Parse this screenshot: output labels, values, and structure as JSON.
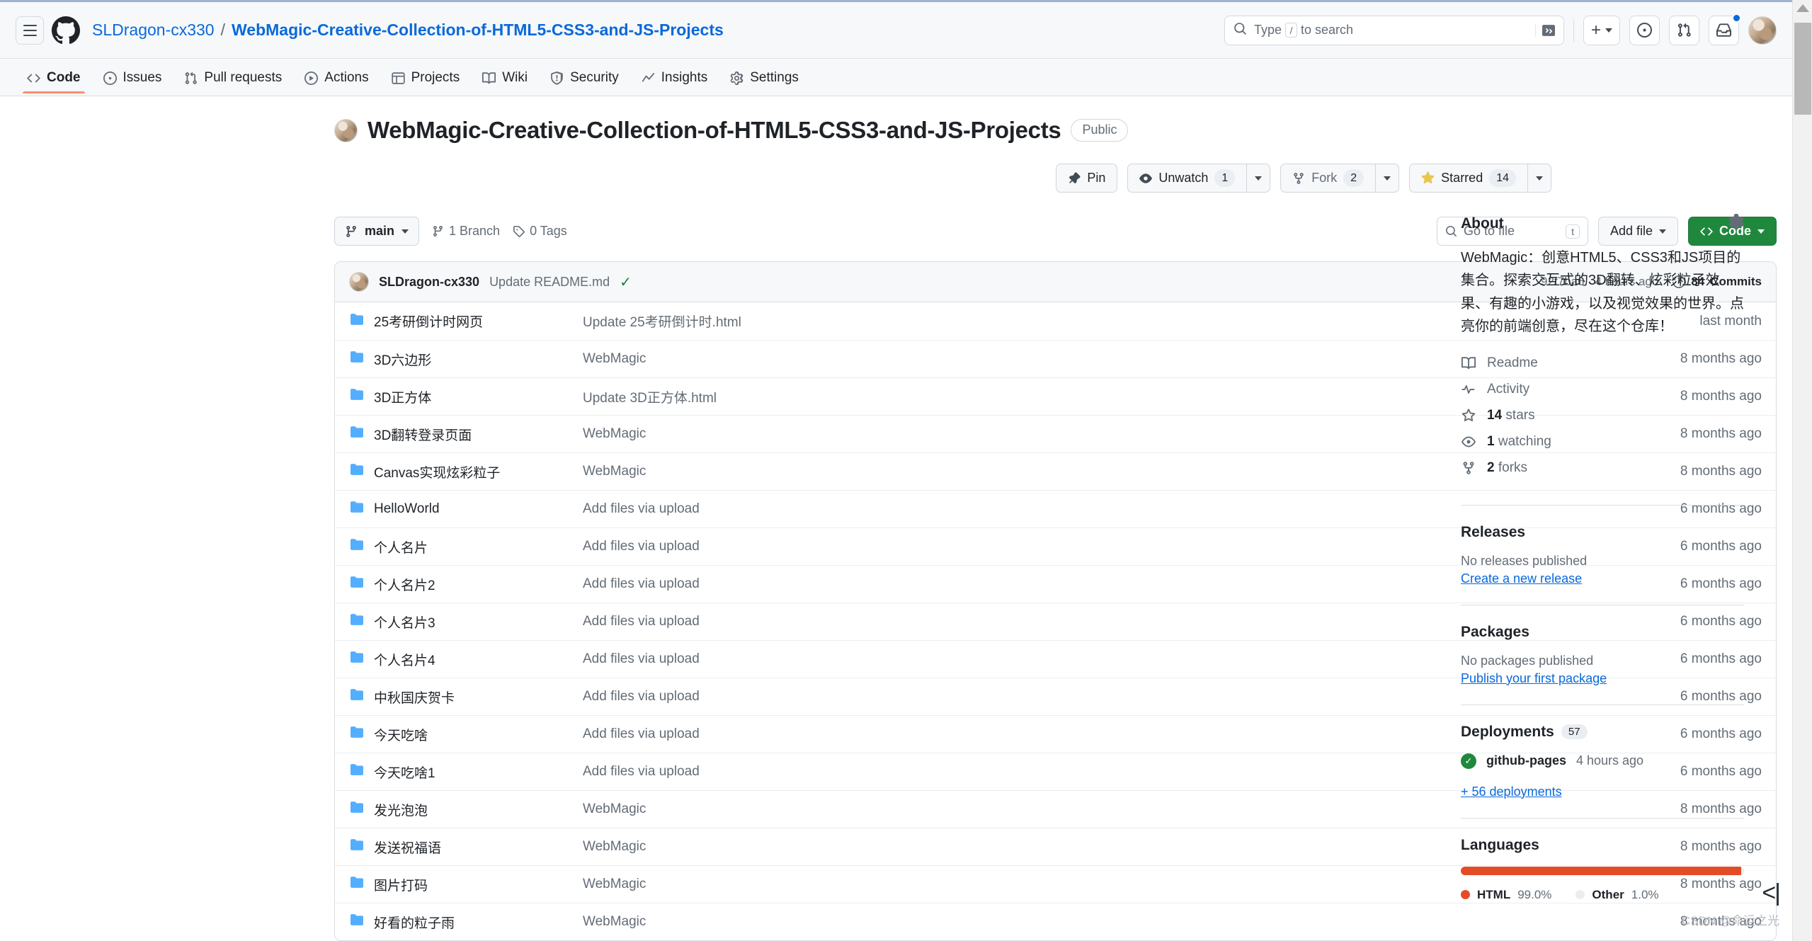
{
  "header": {
    "menu_icon": "hamburger-icon",
    "logo_icon": "github-mark-icon",
    "owner": "SLDragon-cx330",
    "separator": "/",
    "repo": "WebMagic-Creative-Collection-of-HTML5-CSS3-and-JS-Projects",
    "search_placeholder_before": "Type",
    "search_key": "/",
    "search_placeholder_after": "to search",
    "terminal_icon": "command-palette-icon",
    "plus_label": "+",
    "issue_icon": "issue-opened-icon",
    "pull_icon": "pull-request-icon",
    "inbox_icon": "inbox-icon",
    "avatar": "user-avatar"
  },
  "nav": {
    "tabs": [
      {
        "label": "Code",
        "icon": "code-icon",
        "active": true
      },
      {
        "label": "Issues",
        "icon": "issue-opened-icon",
        "active": false
      },
      {
        "label": "Pull requests",
        "icon": "git-pull-request-icon",
        "active": false
      },
      {
        "label": "Actions",
        "icon": "play-icon",
        "active": false
      },
      {
        "label": "Projects",
        "icon": "table-icon",
        "active": false
      },
      {
        "label": "Wiki",
        "icon": "book-icon",
        "active": false
      },
      {
        "label": "Security",
        "icon": "shield-icon",
        "active": false
      },
      {
        "label": "Insights",
        "icon": "graph-icon",
        "active": false
      },
      {
        "label": "Settings",
        "icon": "gear-icon",
        "active": false
      }
    ]
  },
  "repo": {
    "name": "WebMagic-Creative-Collection-of-HTML5-CSS3-and-JS-Projects",
    "visibility": "Public",
    "actions": {
      "pin": "Pin",
      "watch": "Unwatch",
      "watch_count": "1",
      "fork": "Fork",
      "fork_count": "2",
      "star": "Starred",
      "star_count": "14"
    }
  },
  "toolbar": {
    "branch": "main",
    "branches": "1 Branch",
    "tags": "0 Tags",
    "go_to_file": "Go to file",
    "file_key": "t",
    "add_file": "Add file",
    "code": "Code"
  },
  "commit_bar": {
    "author": "SLDragon-cx330",
    "message": "Update README.md",
    "status_icon": "check-icon",
    "hash": "92f7ba6 · 4 hours ago",
    "commits_count": "84",
    "commits_label": "Commits"
  },
  "files": [
    {
      "name": "25考研倒计时网页",
      "type": "folder",
      "message": "Update 25考研倒计时.html",
      "time": "last month"
    },
    {
      "name": "3D六边形",
      "type": "folder",
      "message": "WebMagic",
      "time": "8 months ago"
    },
    {
      "name": "3D正方体",
      "type": "folder",
      "message": "Update 3D正方体.html",
      "time": "8 months ago"
    },
    {
      "name": "3D翻转登录页面",
      "type": "folder",
      "message": "WebMagic",
      "time": "8 months ago"
    },
    {
      "name": "Canvas实现炫彩粒子",
      "type": "folder",
      "message": "WebMagic",
      "time": "8 months ago"
    },
    {
      "name": "HelloWorld",
      "type": "folder",
      "message": "Add files via upload",
      "time": "6 months ago"
    },
    {
      "name": "个人名片",
      "type": "folder",
      "message": "Add files via upload",
      "time": "6 months ago"
    },
    {
      "name": "个人名片2",
      "type": "folder",
      "message": "Add files via upload",
      "time": "6 months ago"
    },
    {
      "name": "个人名片3",
      "type": "folder",
      "message": "Add files via upload",
      "time": "6 months ago"
    },
    {
      "name": "个人名片4",
      "type": "folder",
      "message": "Add files via upload",
      "time": "6 months ago"
    },
    {
      "name": "中秋国庆贺卡",
      "type": "folder",
      "message": "Add files via upload",
      "time": "6 months ago"
    },
    {
      "name": "今天吃啥",
      "type": "folder",
      "message": "Add files via upload",
      "time": "6 months ago"
    },
    {
      "name": "今天吃啥1",
      "type": "folder",
      "message": "Add files via upload",
      "time": "6 months ago"
    },
    {
      "name": "发光泡泡",
      "type": "folder",
      "message": "WebMagic",
      "time": "8 months ago"
    },
    {
      "name": "发送祝福语",
      "type": "folder",
      "message": "WebMagic",
      "time": "8 months ago"
    },
    {
      "name": "图片打码",
      "type": "folder",
      "message": "WebMagic",
      "time": "8 months ago"
    },
    {
      "name": "好看的粒子雨",
      "type": "folder",
      "message": "WebMagic",
      "time": "8 months ago"
    }
  ],
  "sidebar": {
    "about": {
      "title": "About",
      "gear_icon": "gear-icon",
      "description": "WebMagic：创意HTML5、CSS3和JS项目的集合。探索交互式的3D翻转、炫彩粒子效果、有趣的小游戏，以及视觉效果的世界。点亮你的前端创意，尽在这个仓库！",
      "links": [
        {
          "label": "Readme",
          "icon": "book-icon"
        },
        {
          "label": "Activity",
          "icon": "pulse-icon"
        }
      ],
      "stats": [
        {
          "count": "14",
          "label": "stars",
          "icon": "star-icon"
        },
        {
          "count": "1",
          "label": "watching",
          "icon": "eye-icon"
        },
        {
          "count": "2",
          "label": "forks",
          "icon": "repo-forked-icon"
        }
      ]
    },
    "releases": {
      "title": "Releases",
      "empty": "No releases published",
      "action": "Create a new release"
    },
    "packages": {
      "title": "Packages",
      "empty": "No packages published",
      "action": "Publish your first package"
    },
    "deployments": {
      "title": "Deployments",
      "count": "57",
      "entry_name": "github-pages",
      "entry_time": "4 hours ago",
      "more": "+ 56 deployments"
    },
    "languages": {
      "title": "Languages",
      "items": [
        {
          "name": "HTML",
          "percent": "99.0%",
          "color": "#e34c26",
          "width": "99.0"
        },
        {
          "name": "Other",
          "percent": "1.0%",
          "color": "#ededed",
          "width": "1.0"
        }
      ]
    }
  },
  "watermark": "CSDN @命运之光",
  "collapse_icon": "collapse-sidebar-icon"
}
